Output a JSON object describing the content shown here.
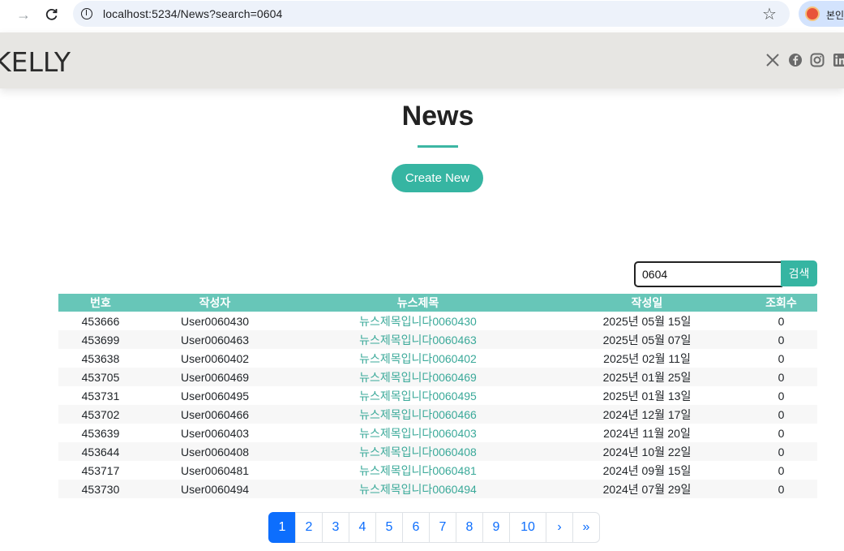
{
  "browser": {
    "url": "localhost:5234/News?search=0604",
    "profile_label": "본인"
  },
  "site": {
    "brand": "KELLY",
    "social": [
      "x-icon",
      "facebook-icon",
      "instagram-icon",
      "linkedin-icon"
    ]
  },
  "page": {
    "title": "News",
    "create_label": "Create New"
  },
  "search": {
    "value": "0604",
    "button_label": "검색"
  },
  "table": {
    "headers": [
      "번호",
      "작성자",
      "뉴스제목",
      "작성일",
      "조회수"
    ],
    "rows": [
      {
        "id": "453666",
        "writer": "User0060430",
        "title": "뉴스제목입니다0060430",
        "date": "2025년 05월 15일",
        "views": "0"
      },
      {
        "id": "453699",
        "writer": "User0060463",
        "title": "뉴스제목입니다0060463",
        "date": "2025년 05월 07일",
        "views": "0"
      },
      {
        "id": "453638",
        "writer": "User0060402",
        "title": "뉴스제목입니다0060402",
        "date": "2025년 02월 11일",
        "views": "0"
      },
      {
        "id": "453705",
        "writer": "User0060469",
        "title": "뉴스제목입니다0060469",
        "date": "2025년 01월 25일",
        "views": "0"
      },
      {
        "id": "453731",
        "writer": "User0060495",
        "title": "뉴스제목입니다0060495",
        "date": "2025년 01월 13일",
        "views": "0"
      },
      {
        "id": "453702",
        "writer": "User0060466",
        "title": "뉴스제목입니다0060466",
        "date": "2024년 12월 17일",
        "views": "0"
      },
      {
        "id": "453639",
        "writer": "User0060403",
        "title": "뉴스제목입니다0060403",
        "date": "2024년 11월 20일",
        "views": "0"
      },
      {
        "id": "453644",
        "writer": "User0060408",
        "title": "뉴스제목입니다0060408",
        "date": "2024년 10월 22일",
        "views": "0"
      },
      {
        "id": "453717",
        "writer": "User0060481",
        "title": "뉴스제목입니다0060481",
        "date": "2024년 09월 15일",
        "views": "0"
      },
      {
        "id": "453730",
        "writer": "User0060494",
        "title": "뉴스제목입니다0060494",
        "date": "2024년 07월 29일",
        "views": "0"
      }
    ]
  },
  "pagination": {
    "pages": [
      "1",
      "2",
      "3",
      "4",
      "5",
      "6",
      "7",
      "8",
      "9",
      "10"
    ],
    "active": "1",
    "next": "›",
    "last": "»"
  },
  "colors": {
    "accent": "#36b5a2",
    "header_row": "#67c6b8",
    "pager_active": "#0d6efd"
  }
}
